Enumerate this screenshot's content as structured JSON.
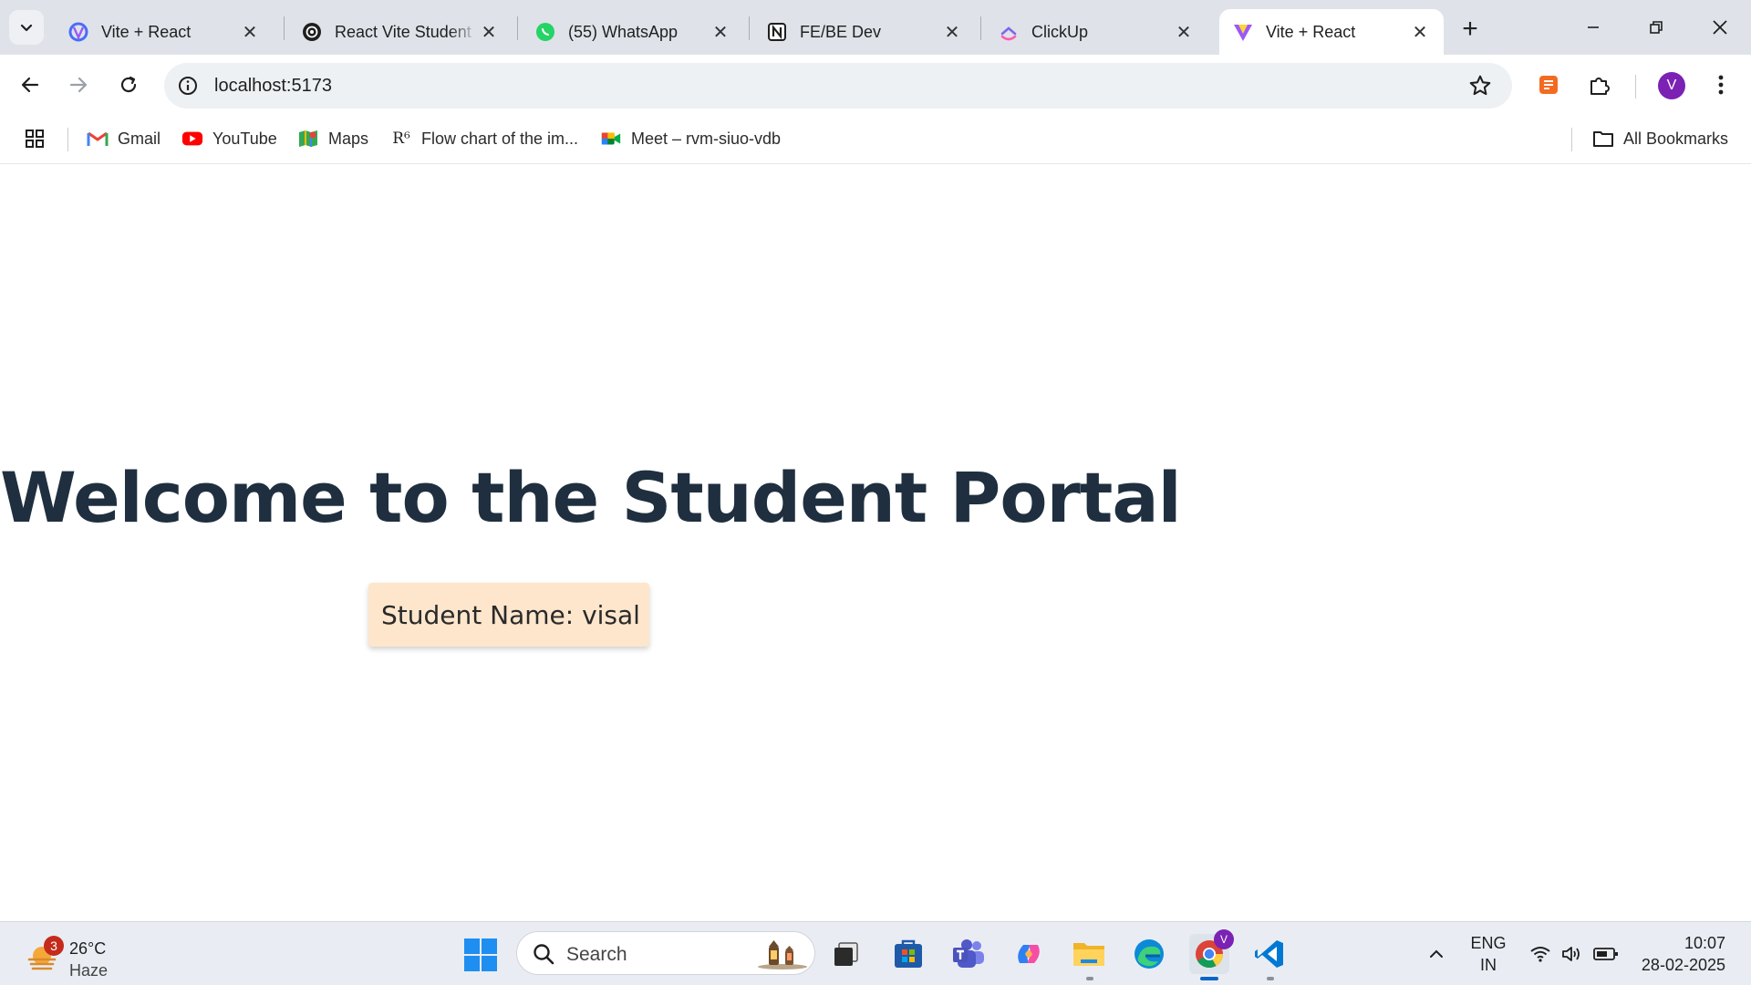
{
  "browser": {
    "tabs": [
      {
        "title": "Vite + React",
        "icon": "chrome-vite-icon",
        "active": false
      },
      {
        "title": "React Vite Student",
        "icon": "openai-icon",
        "active": false
      },
      {
        "title": "(55) WhatsApp",
        "icon": "whatsapp-icon",
        "active": false
      },
      {
        "title": "FE/BE Dev",
        "icon": "notion-icon",
        "active": false
      },
      {
        "title": "ClickUp",
        "icon": "clickup-icon",
        "active": false
      },
      {
        "title": "Vite + React",
        "icon": "vite-icon",
        "active": true
      }
    ],
    "close_glyph": "✕",
    "new_tab_glyph": "+",
    "address": "localhost:5173",
    "profile_initial": "V",
    "colors": {
      "tab_strip": "#dfe3e9",
      "omnibox": "#eef1f4",
      "avatar": "#7b21b4"
    }
  },
  "bookmarks": {
    "items": [
      {
        "label": "Gmail",
        "icon": "gmail-icon"
      },
      {
        "label": "YouTube",
        "icon": "youtube-icon"
      },
      {
        "label": "Maps",
        "icon": "maps-icon"
      },
      {
        "label": "Flow chart of the im...",
        "icon": "researchgate-icon",
        "icon_text": "R⁶"
      },
      {
        "label": "Meet – rvm-siuo-vdb",
        "icon": "meet-icon"
      }
    ],
    "all_bookmarks": "All Bookmarks"
  },
  "page": {
    "heading": "Welcome to the Student Portal",
    "student_card": "Student Name: visal",
    "colors": {
      "heading": "#1f2f3f",
      "card_bg": "#fde6cc"
    }
  },
  "taskbar": {
    "weather": {
      "badge": "3",
      "temp": "26°C",
      "condition": "Haze"
    },
    "search_placeholder": "Search",
    "apps": [
      "file-explorer-window-icon",
      "microsoft-store-icon",
      "teams-icon",
      "copilot-icon",
      "file-explorer-icon",
      "edge-icon",
      "chrome-icon",
      "vscode-icon"
    ],
    "chrome_badge": "V",
    "language": {
      "line1": "ENG",
      "line2": "IN"
    },
    "clock": {
      "time": "10:07",
      "date": "28-02-2025"
    }
  }
}
